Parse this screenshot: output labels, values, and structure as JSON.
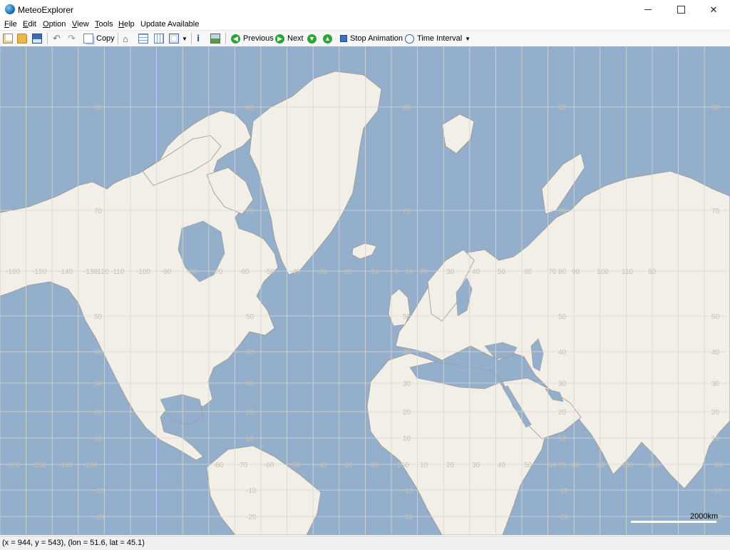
{
  "window": {
    "title": "MeteoExplorer"
  },
  "menu": [
    {
      "label": "File",
      "acc": "F",
      "rest": "ile"
    },
    {
      "label": "Edit",
      "acc": "E",
      "rest": "dit"
    },
    {
      "label": "Option",
      "acc": "O",
      "rest": "ption"
    },
    {
      "label": "View",
      "acc": "V",
      "rest": "iew"
    },
    {
      "label": "Tools",
      "acc": "T",
      "rest": "ools"
    },
    {
      "label": "Help",
      "acc": "H",
      "rest": "elp"
    },
    {
      "label": "Update Available",
      "acc": "",
      "rest": "Update Available"
    }
  ],
  "toolbar": {
    "copy_label": "Copy",
    "previous_label": "Previous",
    "next_label": "Next",
    "stop_animation_label": "Stop Animation",
    "time_interval_label": "Time Interval"
  },
  "map": {
    "longitude_labels_top": [
      "-160",
      "-150",
      "-140",
      "-130",
      "-120",
      "-110",
      "-100",
      "-90",
      "-80",
      "-70",
      "-60",
      "-50",
      "-40",
      "-30",
      "-20",
      "-10",
      "0",
      "10",
      "20",
      "30",
      "40",
      "50",
      "60",
      "70",
      "80",
      "90",
      "100",
      "110",
      "60"
    ],
    "longitude_labels_bottom": [
      "-160",
      "-150",
      "-140",
      "-130",
      "-80",
      "-70",
      "-60",
      "-50",
      "-40",
      "-30",
      "-20",
      "-10",
      "0",
      "10",
      "20",
      "30",
      "40",
      "50",
      "60",
      "70",
      "80",
      "90",
      "100",
      "110",
      "60"
    ],
    "latitude_labels": [
      "80",
      "70",
      "50",
      "40",
      "30",
      "20",
      "10",
      "-10",
      "-20"
    ],
    "scale_label": "2000km",
    "colors": {
      "ocean": "#94afcc",
      "land": "#f2efe9",
      "grid": "#d9d6cf",
      "coast": "#9a9690"
    }
  },
  "status": {
    "text": "(x = 944, y = 543), (lon = 51.6, lat = 45.1)"
  }
}
